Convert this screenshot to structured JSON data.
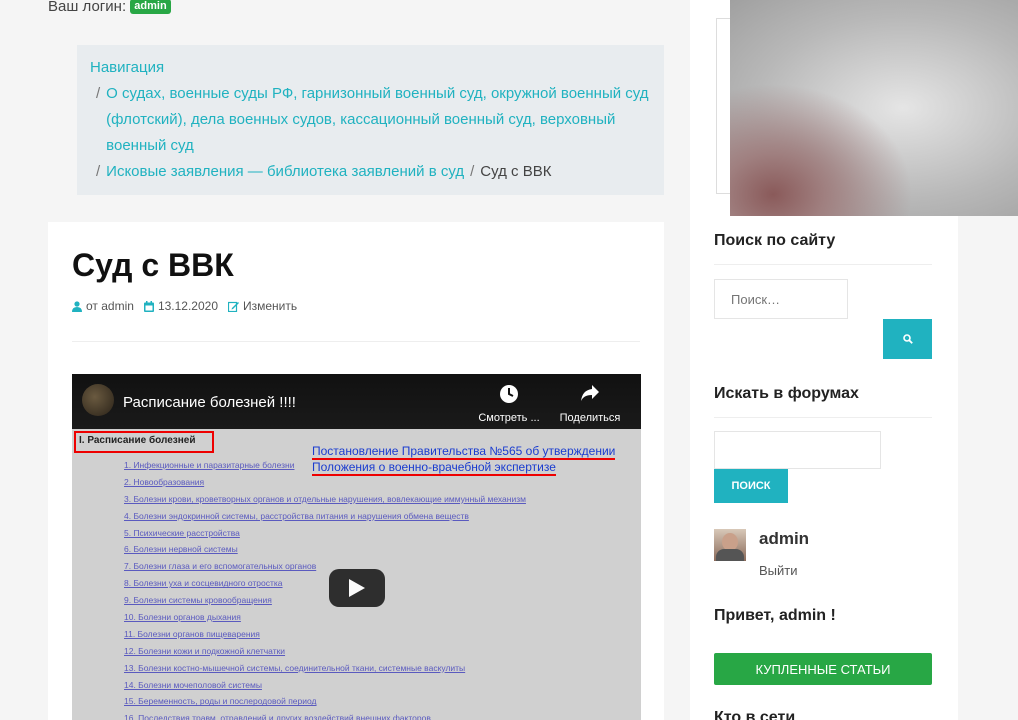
{
  "login": {
    "label": "Ваш логин:",
    "badge": "admin"
  },
  "breadcrumb": {
    "title": "Навигация",
    "sep": "/",
    "items": [
      "О судах, военные суды РФ, гарнизонный военный суд, окружной военный суд (флотский), дела военных судов, кассационный военный суд, верховный военный суд",
      "Исковые заявления — библиотека заявлений в суд"
    ],
    "current": "Суд с ВВК"
  },
  "post": {
    "title": "Суд с ВВК",
    "author": "от admin",
    "date": "13.12.2020",
    "edit": "Изменить"
  },
  "video": {
    "title": "Расписание болезней !!!!",
    "watch_later": "Смотреть ...",
    "share": "Поделиться",
    "doc_heading": "I. Расписание болезней",
    "note_line1": "Постановление Правительства №565 об утверждении",
    "note_line2": "Положения о военно-врачебной экспертизе",
    "items": [
      "1. Инфекционные и паразитарные болезни",
      "2. Новообразования",
      "3. Болезни крови, кроветворных органов и отдельные нарушения, вовлекающие иммунный механизм",
      "4. Болезни эндокринной системы, расстройства питания и нарушения обмена веществ",
      "5. Психические расстройства",
      "6. Болезни нервной системы",
      "7. Болезни глаза и его вспомогательных органов",
      "8. Болезни уха и сосцевидного отростка",
      "9. Болезни системы кровообращения",
      "10. Болезни органов дыхания",
      "11. Болезни органов пищеварения",
      "12. Болезни кожи и подкожной клетчатки",
      "13. Болезни костно-мышечной системы, соединительной ткани, системные васкулиты",
      "14. Болезни мочеполовой системы",
      "15. Беременность, роды и послеродовой период",
      "16. Последствия травм, отравлений и других воздействий внешних факторов"
    ]
  },
  "sidebar": {
    "search_title": "Поиск по сайту",
    "search_placeholder": "Поиск…",
    "forums_title": "Искать в форумах",
    "forums_button": "ПОИСК",
    "user_name": "admin",
    "logout": "Выйти",
    "hello": "Привет, admin !",
    "bought_button": "КУПЛЕННЫЕ СТАТЬИ",
    "who_online": "Кто в сети"
  },
  "colors": {
    "accent": "#20b2c0",
    "green": "#28a745",
    "red": "#e00000"
  }
}
